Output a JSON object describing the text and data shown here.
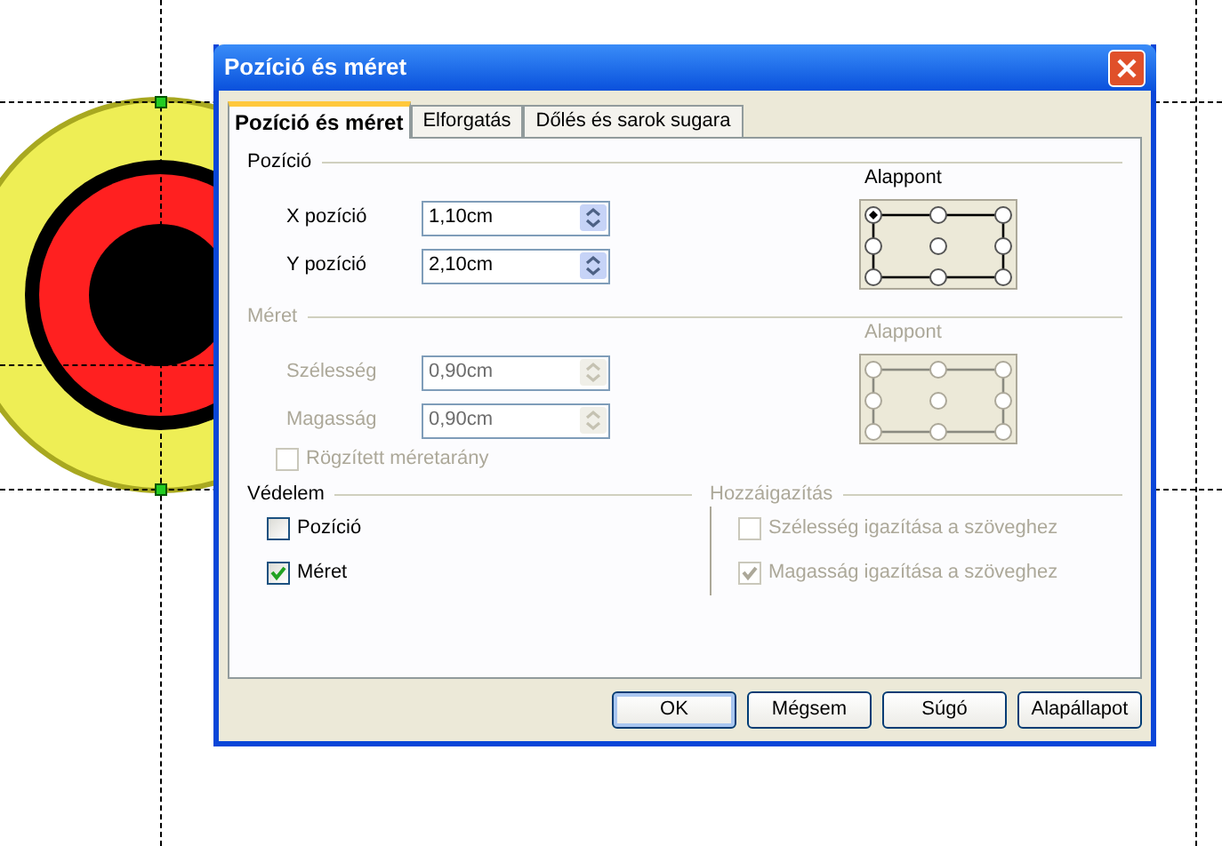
{
  "window": {
    "title": "Pozíció és méret"
  },
  "tabs": [
    {
      "label": "Pozíció és méret",
      "selected": true
    },
    {
      "label": "Elforgatás",
      "selected": false
    },
    {
      "label": "Dőlés és sarok sugara",
      "selected": false
    }
  ],
  "position": {
    "label": "Pozíció",
    "disabled": false,
    "fields": [
      {
        "label": "X pozíció",
        "value": "1,10cm"
      },
      {
        "label": "Y pozíció",
        "value": "2,10cm"
      }
    ],
    "anchor": {
      "label": "Alappont",
      "points": [
        {
          "selected": true
        },
        {
          "selected": false
        },
        {
          "selected": false
        },
        {
          "selected": false
        },
        {
          "selected": false
        },
        {
          "selected": false
        },
        {
          "selected": false
        },
        {
          "selected": false
        },
        {
          "selected": false
        }
      ]
    }
  },
  "size": {
    "label": "Méret",
    "disabled": true,
    "fields": [
      {
        "label": "Szélesség",
        "value": "0,90cm"
      },
      {
        "label": "Magasság",
        "value": "0,90cm"
      }
    ],
    "keep_ratio": {
      "label": "Rögzített méretarány",
      "checked": false
    },
    "anchor": {
      "label": "Alappont",
      "points": [
        {
          "selected": false
        },
        {
          "selected": false
        },
        {
          "selected": false
        },
        {
          "selected": false
        },
        {
          "selected": false
        },
        {
          "selected": false
        },
        {
          "selected": false
        },
        {
          "selected": false
        },
        {
          "selected": false
        }
      ]
    }
  },
  "protect": {
    "label": "Védelem",
    "disabled": false,
    "checkboxes": [
      {
        "label": "Pozíció",
        "checked": false
      },
      {
        "label": "Méret",
        "checked": true
      }
    ]
  },
  "adapt": {
    "label": "Hozzáigazítás",
    "disabled": true,
    "checkboxes": [
      {
        "label": "Szélesség igazítása a szöveghez",
        "checked": false
      },
      {
        "label": "Magasság igazítása a szöveghez",
        "checked": true
      }
    ]
  },
  "buttons": [
    {
      "label": "OK",
      "default": true
    },
    {
      "label": "Mégsem",
      "default": false
    },
    {
      "label": "Súgó",
      "default": false
    },
    {
      "label": "Alapállapot",
      "default": false
    }
  ]
}
